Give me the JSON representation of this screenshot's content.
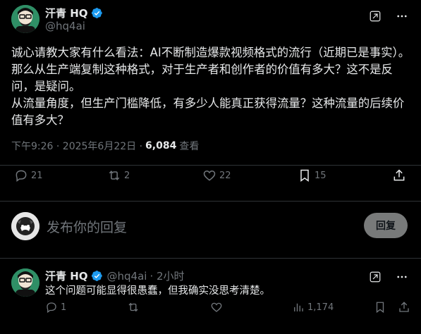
{
  "tweet": {
    "author_name": "汗青 HQ",
    "author_handle": "@hq4ai",
    "text": "诚心请教大家有什么看法：AI不断制造爆款视频格式的流行（近期已是事实）。那么从生产端复制这种格式，对于生产者和创作者的价值有多大？这不是反问，是疑问。\n从流量角度，但生产门槛降低，有多少人能真正获得流量？这种流量的后续价值有多大？",
    "timestamp": "下午9:26 · 2025年6月22日 ·",
    "views_count": "6,084",
    "views_label": "查看",
    "stats": {
      "replies": "21",
      "retweets": "2",
      "likes": "22",
      "bookmarks": "15"
    }
  },
  "compose": {
    "placeholder": "发布你的回复",
    "button_label": "回复"
  },
  "reply": {
    "author_name": "汗青 HQ",
    "author_handle": "@hq4ai",
    "time": "· 2小时",
    "text": "这个问题可能显得很愚蠢，但我确实没思考清楚。",
    "stats": {
      "replies": "1",
      "views": "1,174"
    }
  },
  "colors": {
    "background": "#000000",
    "text": "#e7e9ea",
    "muted": "#71767b",
    "divider": "#2f3336",
    "verified": "#1d9bf0",
    "reply_button": "#787a7a"
  },
  "icons": [
    "verified-badge-icon",
    "grok-icon",
    "more-icon",
    "reply-icon",
    "retweet-icon",
    "like-icon",
    "bookmark-icon",
    "share-icon",
    "views-icon"
  ]
}
